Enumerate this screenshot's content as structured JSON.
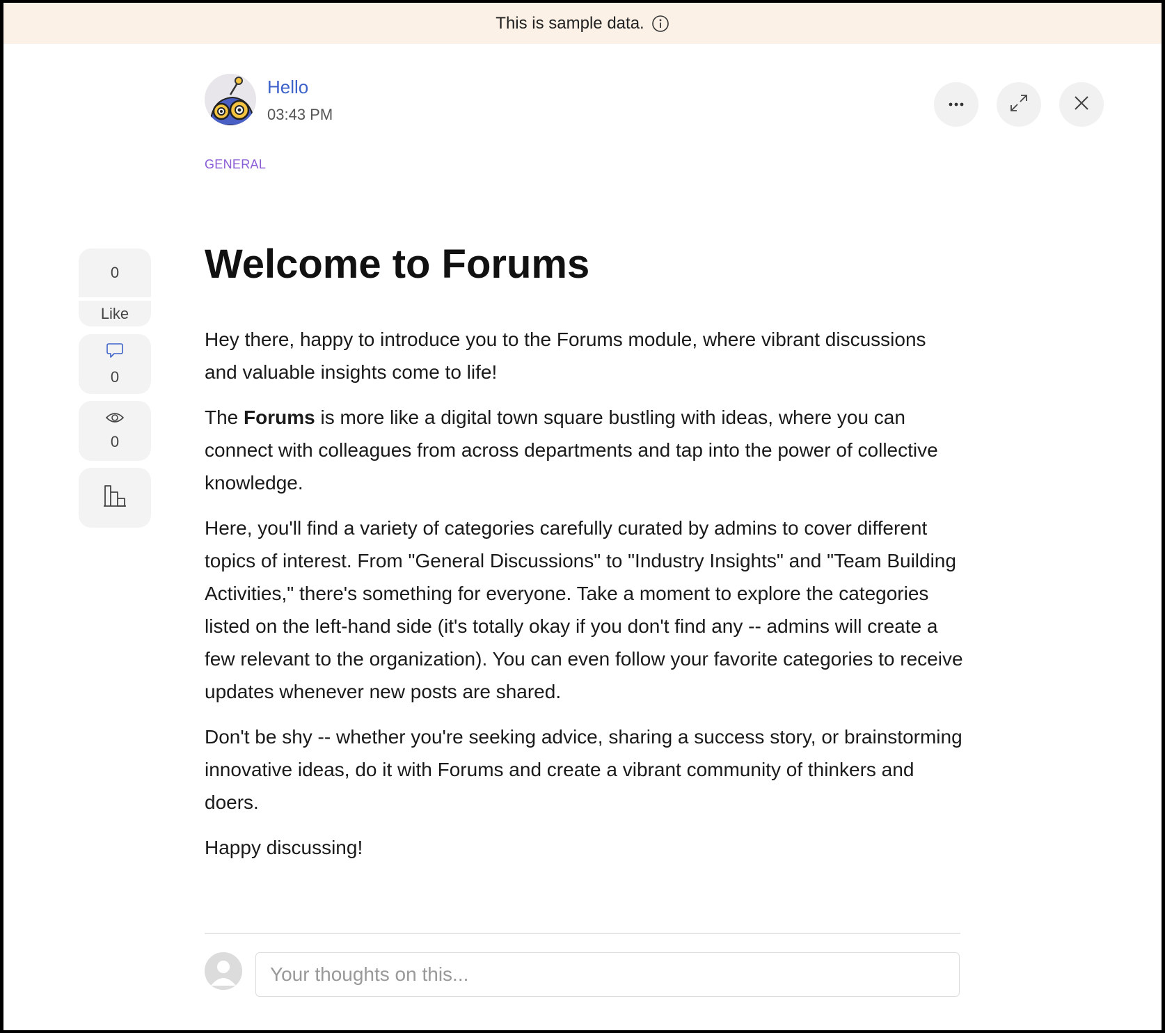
{
  "banner": {
    "text": "This is sample data.",
    "icon": "info-icon"
  },
  "author": {
    "name": "Hello",
    "time": "03:43 PM"
  },
  "header_actions": {
    "more_icon": "ellipsis-icon",
    "expand_icon": "expand-icon",
    "close_icon": "close-icon"
  },
  "post": {
    "category": "GENERAL",
    "title": "Welcome to Forums",
    "paragraphs": {
      "p1": "Hey there, happy to introduce you to the Forums module, where vibrant discussions and valuable insights come to life!",
      "p2_before": "The ",
      "p2_bold": "Forums",
      "p2_after": " is more like a digital town square bustling with ideas, where you can connect with colleagues from across departments and tap into the power of collective knowledge.",
      "p3": "Here, you'll find a variety of categories carefully curated by admins to cover different topics of interest. From \"General Discussions\" to \"Industry Insights\" and \"Team Building Activities,\" there's something for everyone. Take a moment to explore the categories listed on the left-hand side (it's totally okay if you don't find any -- admins will create a few relevant to the organization). You can even follow your favorite categories to receive updates whenever new posts are shared.",
      "p4": "Don't be shy -- whether you're seeking advice, sharing a success story, or brainstorming innovative ideas, do it with Forums and create a vibrant community of thinkers and doers.",
      "p5": "Happy discussing!"
    }
  },
  "side_actions": {
    "likes": {
      "count": "0",
      "label": "Like"
    },
    "comments": {
      "count": "0",
      "icon": "comment-icon"
    },
    "views": {
      "count": "0",
      "icon": "eye-icon"
    },
    "stats": {
      "icon": "bar-chart-icon"
    }
  },
  "comment_box": {
    "placeholder": "Your thoughts on this...",
    "value": ""
  },
  "colors": {
    "banner_bg": "#fcf1e6",
    "author_link": "#3d62c9",
    "category": "#8a5cd6",
    "comment_icon": "#3d62c9"
  }
}
